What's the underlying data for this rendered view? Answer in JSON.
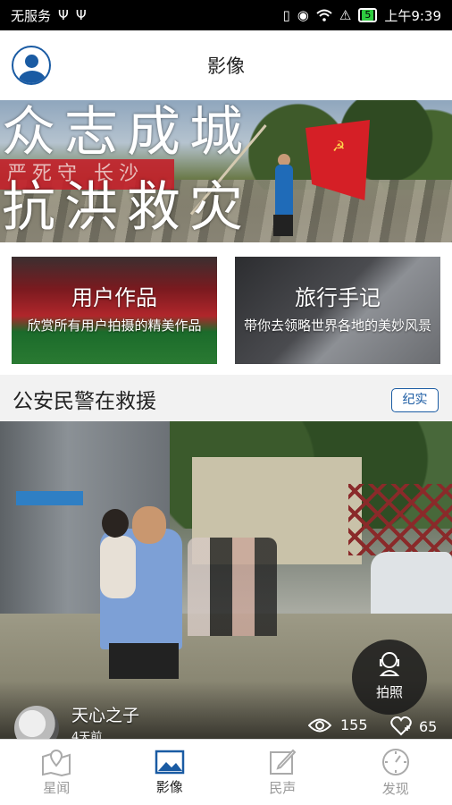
{
  "status_bar": {
    "carrier": "无服务",
    "usb1": "Ψ",
    "usb2": "Ψ",
    "battery": "5",
    "time": "上午9:39"
  },
  "header": {
    "title": "影像"
  },
  "banner": {
    "line1": "众志成城",
    "line2": "抗洪救灾",
    "strip_text": "严死守  长沙"
  },
  "cards": [
    {
      "title": "用户作品",
      "subtitle": "欣赏所有用户拍摄的精美作品"
    },
    {
      "title": "旅行手记",
      "subtitle": "带你去领略世界各地的美妙风景"
    }
  ],
  "section": {
    "title": "公安民警在救援",
    "tag": "纪实"
  },
  "post": {
    "author": "天心之子",
    "time": "4天前",
    "views": "155",
    "likes": "65"
  },
  "fab": {
    "label": "拍照"
  },
  "tabs": [
    {
      "label": "星闻",
      "icon": "map-pin-icon",
      "active": false
    },
    {
      "label": "影像",
      "icon": "image-icon",
      "active": true
    },
    {
      "label": "民声",
      "icon": "edit-icon",
      "active": false
    },
    {
      "label": "发现",
      "icon": "compass-icon",
      "active": false
    }
  ],
  "colors": {
    "accent": "#1a5ba3",
    "tab_active": "#222222",
    "tab_inactive": "#999999"
  }
}
